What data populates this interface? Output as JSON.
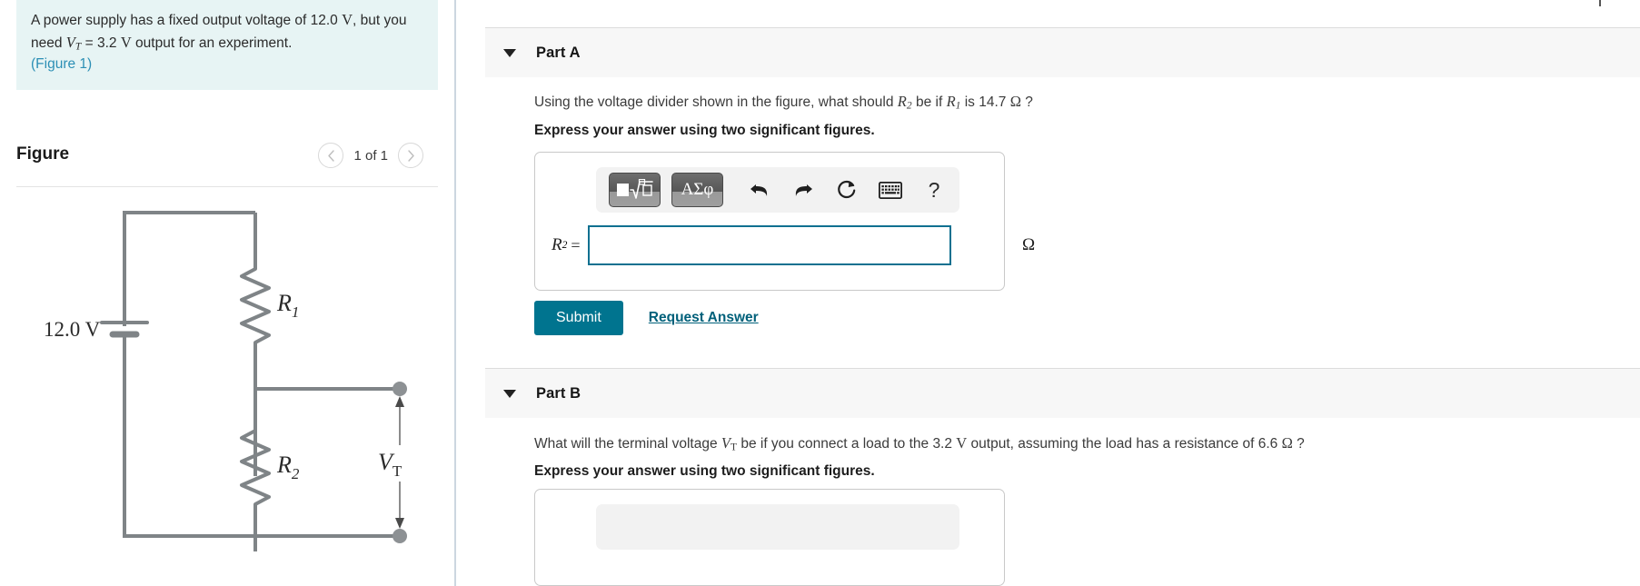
{
  "problem": {
    "text_before": "A power supply has a fixed output voltage of 12.0 ",
    "unit_v": "V",
    "text_mid": ", but you need ",
    "var_vt": "V",
    "var_vt_sub": "T",
    "text_eq": " = 3.2 ",
    "unit_v2": "V",
    "text_after": " output for an experiment.",
    "figure_link": "(Figure 1)"
  },
  "figure": {
    "title": "Figure",
    "prev_icon": "chevron-left-icon",
    "next_icon": "chevron-right-icon",
    "counter": "1 of 1",
    "circuit": {
      "source_label": "12.0 V",
      "r1_label": "R",
      "r1_sub": "1",
      "r2_label": "R",
      "r2_sub": "2",
      "vt_label": "V",
      "vt_sub": "T",
      "wire_color": "#7f8487"
    }
  },
  "parts": {
    "a": {
      "caret_icon": "caret-down-icon",
      "label": "Part A",
      "question_1": "Using the voltage divider shown in the figure, what should ",
      "question_var1": "R",
      "question_var1_sub": "2",
      "question_2": " be if ",
      "question_var2": "R",
      "question_var2_sub": "1",
      "question_3": " is 14.7 ",
      "question_omega": "Ω",
      "question_4": " ?",
      "instruction": "Express your answer using two significant figures.",
      "toolbar": {
        "sqrt_button": "template-math-button",
        "greek_button": "ΑΣφ",
        "undo_icon": "undo-arrow-icon",
        "redo_icon": "redo-arrow-icon",
        "reset_icon": "reset-circular-arrow-icon",
        "keyboard_icon": "keyboard-icon",
        "help_icon": "question-mark-icon",
        "help_label": "?"
      },
      "answer_label": "R",
      "answer_label_sub": "2",
      "answer_equals": "=",
      "answer_value": "",
      "answer_placeholder": "",
      "answer_unit": "Ω",
      "submit_label": "Submit",
      "request_label": "Request Answer"
    },
    "b": {
      "caret_icon": "caret-down-icon",
      "label": "Part B",
      "question_1": "What will the terminal voltage ",
      "question_var1": "V",
      "question_var1_sub": "T",
      "question_2": " be if you connect a load to the 3.2 ",
      "question_unit_v": "V",
      "question_3": " output, assuming the load has a resistance of 6.6 ",
      "question_omega": "Ω",
      "question_4": " ?",
      "instruction": "Express your answer using two significant figures."
    }
  },
  "colors": {
    "prompt_background": "#e7f4f4",
    "link": "#2c8fb5",
    "accent_teal": "#00748f",
    "input_border": "#0e7090",
    "panel_header": "#f7f7f7",
    "divider": "#ccd6e0"
  }
}
